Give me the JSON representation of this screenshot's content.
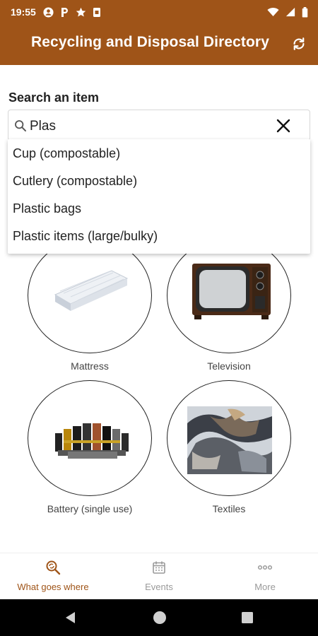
{
  "status_bar": {
    "time": "19:55"
  },
  "header": {
    "title": "Recycling and Disposal Directory"
  },
  "search": {
    "label": "Search an item",
    "value": "Plas",
    "suggestions": [
      "Cup (compostable)",
      "Cutlery (compostable)",
      "Plastic bags",
      "Plastic items (large/bulky)"
    ]
  },
  "items": [
    {
      "label": "Mattress"
    },
    {
      "label": "Television"
    },
    {
      "label": "Battery (single use)"
    },
    {
      "label": "Textiles"
    }
  ],
  "bottom_nav": [
    {
      "label": "What goes where",
      "icon": "search-recycle-icon",
      "active": true
    },
    {
      "label": "Events",
      "icon": "calendar-icon",
      "active": false
    },
    {
      "label": "More",
      "icon": "more-dots-icon",
      "active": false
    }
  ],
  "colors": {
    "brand": "#9f5418",
    "active": "#9f5418",
    "inactive": "#9a9a9a"
  }
}
